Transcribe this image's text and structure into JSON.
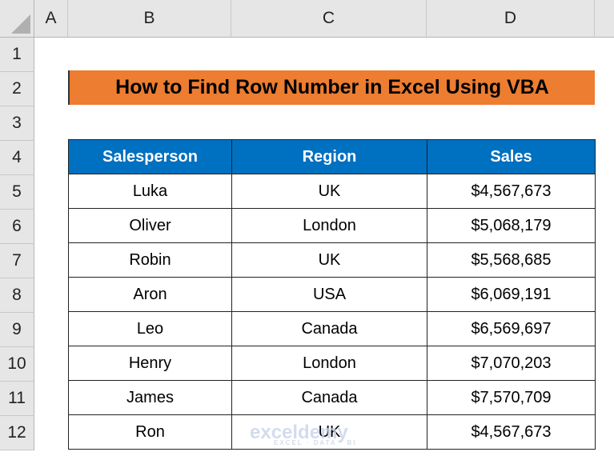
{
  "columns": [
    "A",
    "B",
    "C",
    "D"
  ],
  "rows": [
    "1",
    "2",
    "3",
    "4",
    "5",
    "6",
    "7",
    "8",
    "9",
    "10",
    "11",
    "12"
  ],
  "title": "How to Find Row Number in Excel Using VBA",
  "table": {
    "headers": [
      "Salesperson",
      "Region",
      "Sales"
    ],
    "rows": [
      [
        "Luka",
        "UK",
        "$4,567,673"
      ],
      [
        "Oliver",
        "London",
        "$5,068,179"
      ],
      [
        "Robin",
        "UK",
        "$5,568,685"
      ],
      [
        "Aron",
        "USA",
        "$6,069,191"
      ],
      [
        "Leo",
        "Canada",
        "$6,569,697"
      ],
      [
        "Henry",
        "London",
        "$7,070,203"
      ],
      [
        "James",
        "Canada",
        "$7,570,709"
      ],
      [
        "Ron",
        "UK",
        "$4,567,673"
      ]
    ]
  },
  "watermark": {
    "name": "exceldemy",
    "tagline": "EXCEL · DATA · BI"
  },
  "colors": {
    "title_bg": "#ed7d31",
    "header_bg": "#0070c0"
  }
}
